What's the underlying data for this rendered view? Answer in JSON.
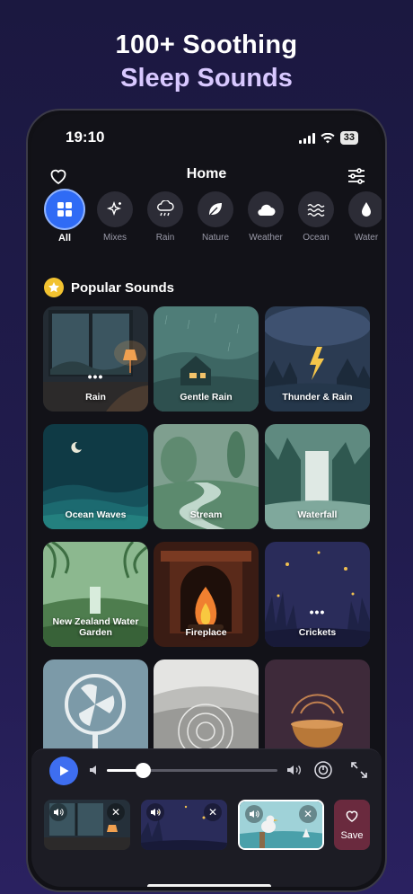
{
  "headline": {
    "line1": "100+ Soothing",
    "line2": "Sleep Sounds"
  },
  "status": {
    "time": "19:10",
    "battery": "33"
  },
  "nav": {
    "title": "Home",
    "left_icon": "heart-icon",
    "right_icon": "sliders-icon"
  },
  "categories": [
    {
      "label": "All",
      "icon": "grid-icon",
      "active": true
    },
    {
      "label": "Mixes",
      "icon": "sparkles-icon"
    },
    {
      "label": "Rain",
      "icon": "rain-cloud-icon"
    },
    {
      "label": "Nature",
      "icon": "leaf-icon"
    },
    {
      "label": "Weather",
      "icon": "cloud-icon"
    },
    {
      "label": "Ocean",
      "icon": "waves-icon"
    },
    {
      "label": "Water",
      "icon": "drop-icon"
    }
  ],
  "section": {
    "title": "Popular Sounds",
    "icon": "star-icon"
  },
  "sounds": [
    {
      "name": "Rain",
      "playing": true
    },
    {
      "name": "Gentle Rain"
    },
    {
      "name": "Thunder & Rain"
    },
    {
      "name": "Ocean Waves"
    },
    {
      "name": "Stream"
    },
    {
      "name": "Waterfall"
    },
    {
      "name": "New Zealand Water Garden"
    },
    {
      "name": "Fireplace"
    },
    {
      "name": "Crickets",
      "playing": true
    },
    {
      "name": ""
    },
    {
      "name": ""
    },
    {
      "name": ""
    }
  ],
  "player": {
    "volume": 0.21,
    "mixer": [
      "Rain",
      "Crickets",
      "Seagull"
    ],
    "save_label": "Save"
  },
  "colors": {
    "accent": "#2f6bf5",
    "save": "#6a2a3e",
    "star": "#f2c230"
  }
}
